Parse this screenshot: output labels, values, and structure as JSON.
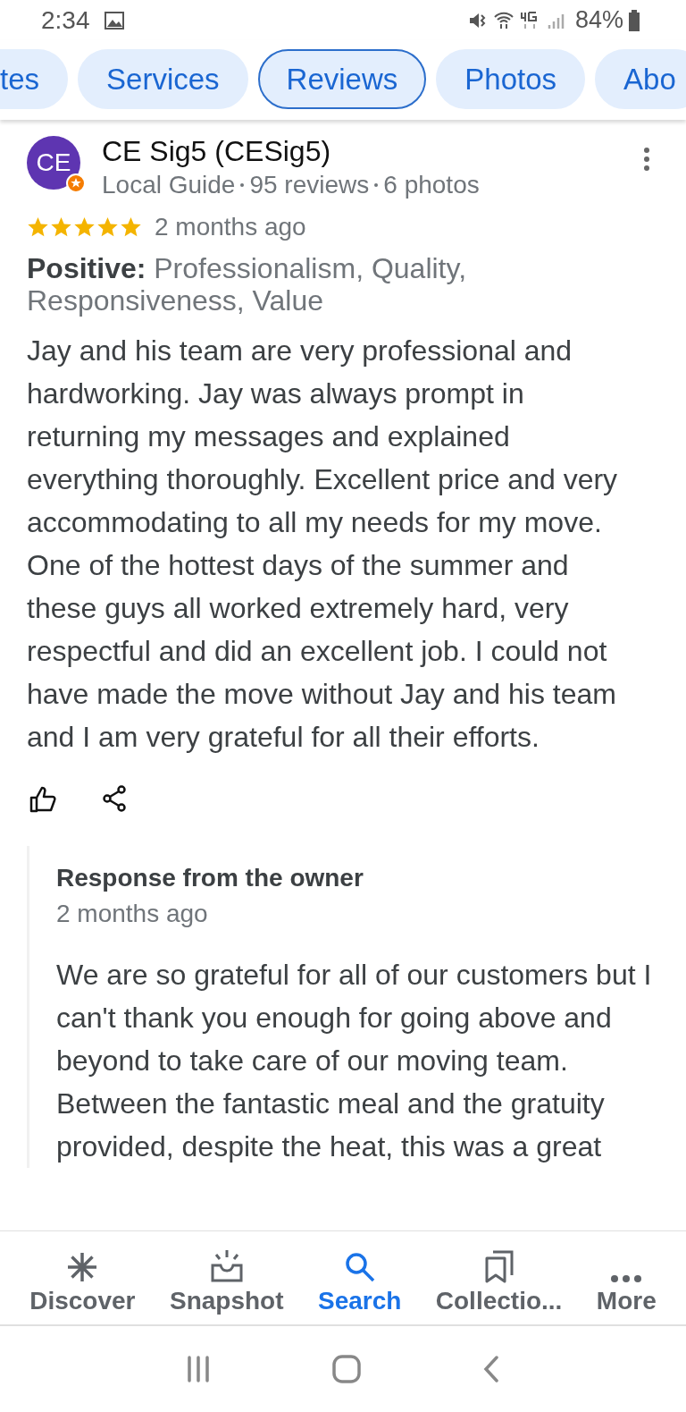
{
  "status_bar": {
    "time": "2:34",
    "battery": "84%"
  },
  "tabs": [
    {
      "label": "tes",
      "selected": false
    },
    {
      "label": "Services",
      "selected": false
    },
    {
      "label": "Reviews",
      "selected": true
    },
    {
      "label": "Photos",
      "selected": false
    },
    {
      "label": "Abo",
      "selected": false
    }
  ],
  "review": {
    "avatar": "CE",
    "author": "CE Sig5 (CESig5)",
    "meta": [
      "Local Guide",
      "95 reviews",
      "6 photos"
    ],
    "stars": 5,
    "time": "2 months ago",
    "positive_label": "Positive:",
    "positive": "Professionalism, Quality, Responsiveness, Value",
    "text": "Jay and his team are very professional and hardworking. Jay was always prompt in returning my messages and explained everything thoroughly. Excellent price and very accommodating to all my needs for my move. One of the hottest days of the summer and these guys all worked extremely hard, very respectful and did an excellent job. I could not have made the move without Jay and his team and I am very grateful for all their efforts."
  },
  "owner_response": {
    "title": "Response from the owner",
    "time": "2 months ago",
    "text": "We are so grateful for all of our customers but I can't thank you enough for going above and beyond to take care of our moving team. Between the fantastic meal and the gratuity provided, despite the heat, this was a great"
  },
  "bottom_nav": [
    {
      "kind": "discover",
      "label": "Discover",
      "selected": false
    },
    {
      "kind": "snapshot",
      "label": "Snapshot",
      "selected": false
    },
    {
      "kind": "search",
      "label": "Search",
      "selected": true
    },
    {
      "kind": "collections",
      "label": "Collectio...",
      "selected": false
    },
    {
      "kind": "more",
      "label": "More",
      "selected": false
    }
  ]
}
